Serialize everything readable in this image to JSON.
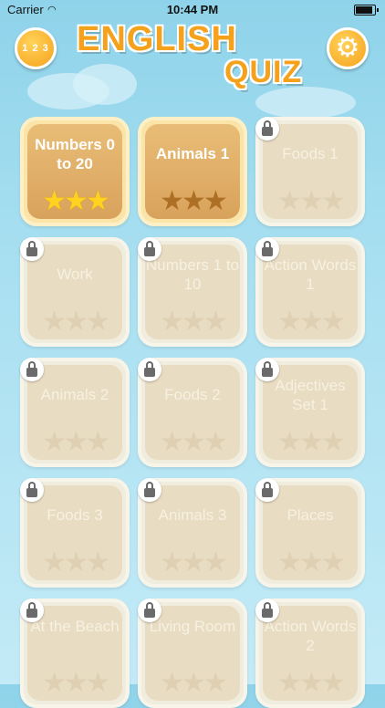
{
  "status_bar": {
    "carrier": "Carrier",
    "time": "10:44 PM",
    "wifi_icon": "wifi-icon",
    "battery_icon": "battery-icon"
  },
  "header": {
    "title_line1": "ENGLISH",
    "title_line2": "QUIZ",
    "leaderboard_button": {
      "icon": "leaderboard-icon",
      "label": "1 2 3"
    },
    "settings_button": {
      "icon": "gear-icon",
      "label": "⚙"
    }
  },
  "colors": {
    "accent": "#f6a11b",
    "tile_unlocked": "#d8a25c",
    "tile_locked": "#e8dcc2",
    "star_gold": "#ffd21f",
    "star_dark": "#ad6f24",
    "sky": "#a9e0f1"
  },
  "levels": [
    {
      "label": "Numbers 0 to 20",
      "state": "unlocked",
      "stars_earned": 3,
      "stars_total": 3
    },
    {
      "label": "Animals 1",
      "state": "unlocked",
      "stars_earned": 0,
      "stars_total": 3
    },
    {
      "label": "Foods 1",
      "state": "locked",
      "stars_earned": 0,
      "stars_total": 3
    },
    {
      "label": "Work",
      "state": "locked",
      "stars_earned": 0,
      "stars_total": 3
    },
    {
      "label": "Numbers 1 to 10",
      "state": "locked",
      "stars_earned": 0,
      "stars_total": 3
    },
    {
      "label": "Action Words 1",
      "state": "locked",
      "stars_earned": 0,
      "stars_total": 3
    },
    {
      "label": "Animals 2",
      "state": "locked",
      "stars_earned": 0,
      "stars_total": 3
    },
    {
      "label": "Foods 2",
      "state": "locked",
      "stars_earned": 0,
      "stars_total": 3
    },
    {
      "label": "Adjectives Set 1",
      "state": "locked",
      "stars_earned": 0,
      "stars_total": 3
    },
    {
      "label": "Foods 3",
      "state": "locked",
      "stars_earned": 0,
      "stars_total": 3
    },
    {
      "label": "Animals 3",
      "state": "locked",
      "stars_earned": 0,
      "stars_total": 3
    },
    {
      "label": "Places",
      "state": "locked",
      "stars_earned": 0,
      "stars_total": 3
    },
    {
      "label": "At the Beach",
      "state": "locked",
      "stars_earned": 0,
      "stars_total": 3
    },
    {
      "label": "Living Room",
      "state": "locked",
      "stars_earned": 0,
      "stars_total": 3
    },
    {
      "label": "Action Words 2",
      "state": "locked",
      "stars_earned": 0,
      "stars_total": 3
    }
  ]
}
